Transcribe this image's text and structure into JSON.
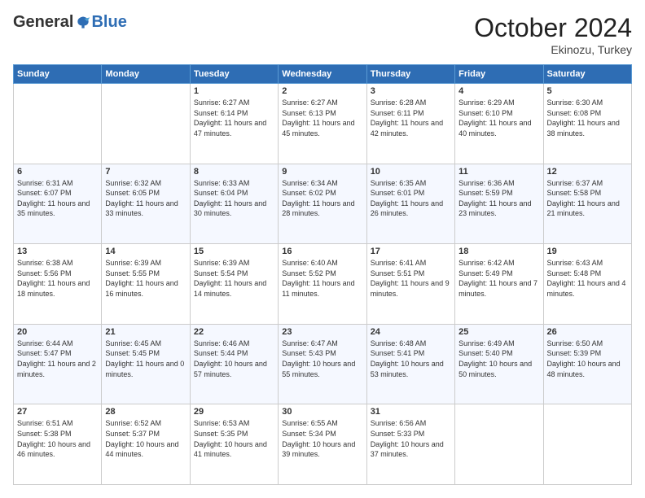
{
  "logo": {
    "general": "General",
    "blue": "Blue"
  },
  "header": {
    "month": "October 2024",
    "location": "Ekinozu, Turkey"
  },
  "weekdays": [
    "Sunday",
    "Monday",
    "Tuesday",
    "Wednesday",
    "Thursday",
    "Friday",
    "Saturday"
  ],
  "weeks": [
    [
      {
        "day": "",
        "sunrise": "",
        "sunset": "",
        "daylight": ""
      },
      {
        "day": "",
        "sunrise": "",
        "sunset": "",
        "daylight": ""
      },
      {
        "day": "1",
        "sunrise": "Sunrise: 6:27 AM",
        "sunset": "Sunset: 6:14 PM",
        "daylight": "Daylight: 11 hours and 47 minutes."
      },
      {
        "day": "2",
        "sunrise": "Sunrise: 6:27 AM",
        "sunset": "Sunset: 6:13 PM",
        "daylight": "Daylight: 11 hours and 45 minutes."
      },
      {
        "day": "3",
        "sunrise": "Sunrise: 6:28 AM",
        "sunset": "Sunset: 6:11 PM",
        "daylight": "Daylight: 11 hours and 42 minutes."
      },
      {
        "day": "4",
        "sunrise": "Sunrise: 6:29 AM",
        "sunset": "Sunset: 6:10 PM",
        "daylight": "Daylight: 11 hours and 40 minutes."
      },
      {
        "day": "5",
        "sunrise": "Sunrise: 6:30 AM",
        "sunset": "Sunset: 6:08 PM",
        "daylight": "Daylight: 11 hours and 38 minutes."
      }
    ],
    [
      {
        "day": "6",
        "sunrise": "Sunrise: 6:31 AM",
        "sunset": "Sunset: 6:07 PM",
        "daylight": "Daylight: 11 hours and 35 minutes."
      },
      {
        "day": "7",
        "sunrise": "Sunrise: 6:32 AM",
        "sunset": "Sunset: 6:05 PM",
        "daylight": "Daylight: 11 hours and 33 minutes."
      },
      {
        "day": "8",
        "sunrise": "Sunrise: 6:33 AM",
        "sunset": "Sunset: 6:04 PM",
        "daylight": "Daylight: 11 hours and 30 minutes."
      },
      {
        "day": "9",
        "sunrise": "Sunrise: 6:34 AM",
        "sunset": "Sunset: 6:02 PM",
        "daylight": "Daylight: 11 hours and 28 minutes."
      },
      {
        "day": "10",
        "sunrise": "Sunrise: 6:35 AM",
        "sunset": "Sunset: 6:01 PM",
        "daylight": "Daylight: 11 hours and 26 minutes."
      },
      {
        "day": "11",
        "sunrise": "Sunrise: 6:36 AM",
        "sunset": "Sunset: 5:59 PM",
        "daylight": "Daylight: 11 hours and 23 minutes."
      },
      {
        "day": "12",
        "sunrise": "Sunrise: 6:37 AM",
        "sunset": "Sunset: 5:58 PM",
        "daylight": "Daylight: 11 hours and 21 minutes."
      }
    ],
    [
      {
        "day": "13",
        "sunrise": "Sunrise: 6:38 AM",
        "sunset": "Sunset: 5:56 PM",
        "daylight": "Daylight: 11 hours and 18 minutes."
      },
      {
        "day": "14",
        "sunrise": "Sunrise: 6:39 AM",
        "sunset": "Sunset: 5:55 PM",
        "daylight": "Daylight: 11 hours and 16 minutes."
      },
      {
        "day": "15",
        "sunrise": "Sunrise: 6:39 AM",
        "sunset": "Sunset: 5:54 PM",
        "daylight": "Daylight: 11 hours and 14 minutes."
      },
      {
        "day": "16",
        "sunrise": "Sunrise: 6:40 AM",
        "sunset": "Sunset: 5:52 PM",
        "daylight": "Daylight: 11 hours and 11 minutes."
      },
      {
        "day": "17",
        "sunrise": "Sunrise: 6:41 AM",
        "sunset": "Sunset: 5:51 PM",
        "daylight": "Daylight: 11 hours and 9 minutes."
      },
      {
        "day": "18",
        "sunrise": "Sunrise: 6:42 AM",
        "sunset": "Sunset: 5:49 PM",
        "daylight": "Daylight: 11 hours and 7 minutes."
      },
      {
        "day": "19",
        "sunrise": "Sunrise: 6:43 AM",
        "sunset": "Sunset: 5:48 PM",
        "daylight": "Daylight: 11 hours and 4 minutes."
      }
    ],
    [
      {
        "day": "20",
        "sunrise": "Sunrise: 6:44 AM",
        "sunset": "Sunset: 5:47 PM",
        "daylight": "Daylight: 11 hours and 2 minutes."
      },
      {
        "day": "21",
        "sunrise": "Sunrise: 6:45 AM",
        "sunset": "Sunset: 5:45 PM",
        "daylight": "Daylight: 11 hours and 0 minutes."
      },
      {
        "day": "22",
        "sunrise": "Sunrise: 6:46 AM",
        "sunset": "Sunset: 5:44 PM",
        "daylight": "Daylight: 10 hours and 57 minutes."
      },
      {
        "day": "23",
        "sunrise": "Sunrise: 6:47 AM",
        "sunset": "Sunset: 5:43 PM",
        "daylight": "Daylight: 10 hours and 55 minutes."
      },
      {
        "day": "24",
        "sunrise": "Sunrise: 6:48 AM",
        "sunset": "Sunset: 5:41 PM",
        "daylight": "Daylight: 10 hours and 53 minutes."
      },
      {
        "day": "25",
        "sunrise": "Sunrise: 6:49 AM",
        "sunset": "Sunset: 5:40 PM",
        "daylight": "Daylight: 10 hours and 50 minutes."
      },
      {
        "day": "26",
        "sunrise": "Sunrise: 6:50 AM",
        "sunset": "Sunset: 5:39 PM",
        "daylight": "Daylight: 10 hours and 48 minutes."
      }
    ],
    [
      {
        "day": "27",
        "sunrise": "Sunrise: 6:51 AM",
        "sunset": "Sunset: 5:38 PM",
        "daylight": "Daylight: 10 hours and 46 minutes."
      },
      {
        "day": "28",
        "sunrise": "Sunrise: 6:52 AM",
        "sunset": "Sunset: 5:37 PM",
        "daylight": "Daylight: 10 hours and 44 minutes."
      },
      {
        "day": "29",
        "sunrise": "Sunrise: 6:53 AM",
        "sunset": "Sunset: 5:35 PM",
        "daylight": "Daylight: 10 hours and 41 minutes."
      },
      {
        "day": "30",
        "sunrise": "Sunrise: 6:55 AM",
        "sunset": "Sunset: 5:34 PM",
        "daylight": "Daylight: 10 hours and 39 minutes."
      },
      {
        "day": "31",
        "sunrise": "Sunrise: 6:56 AM",
        "sunset": "Sunset: 5:33 PM",
        "daylight": "Daylight: 10 hours and 37 minutes."
      },
      {
        "day": "",
        "sunrise": "",
        "sunset": "",
        "daylight": ""
      },
      {
        "day": "",
        "sunrise": "",
        "sunset": "",
        "daylight": ""
      }
    ]
  ]
}
